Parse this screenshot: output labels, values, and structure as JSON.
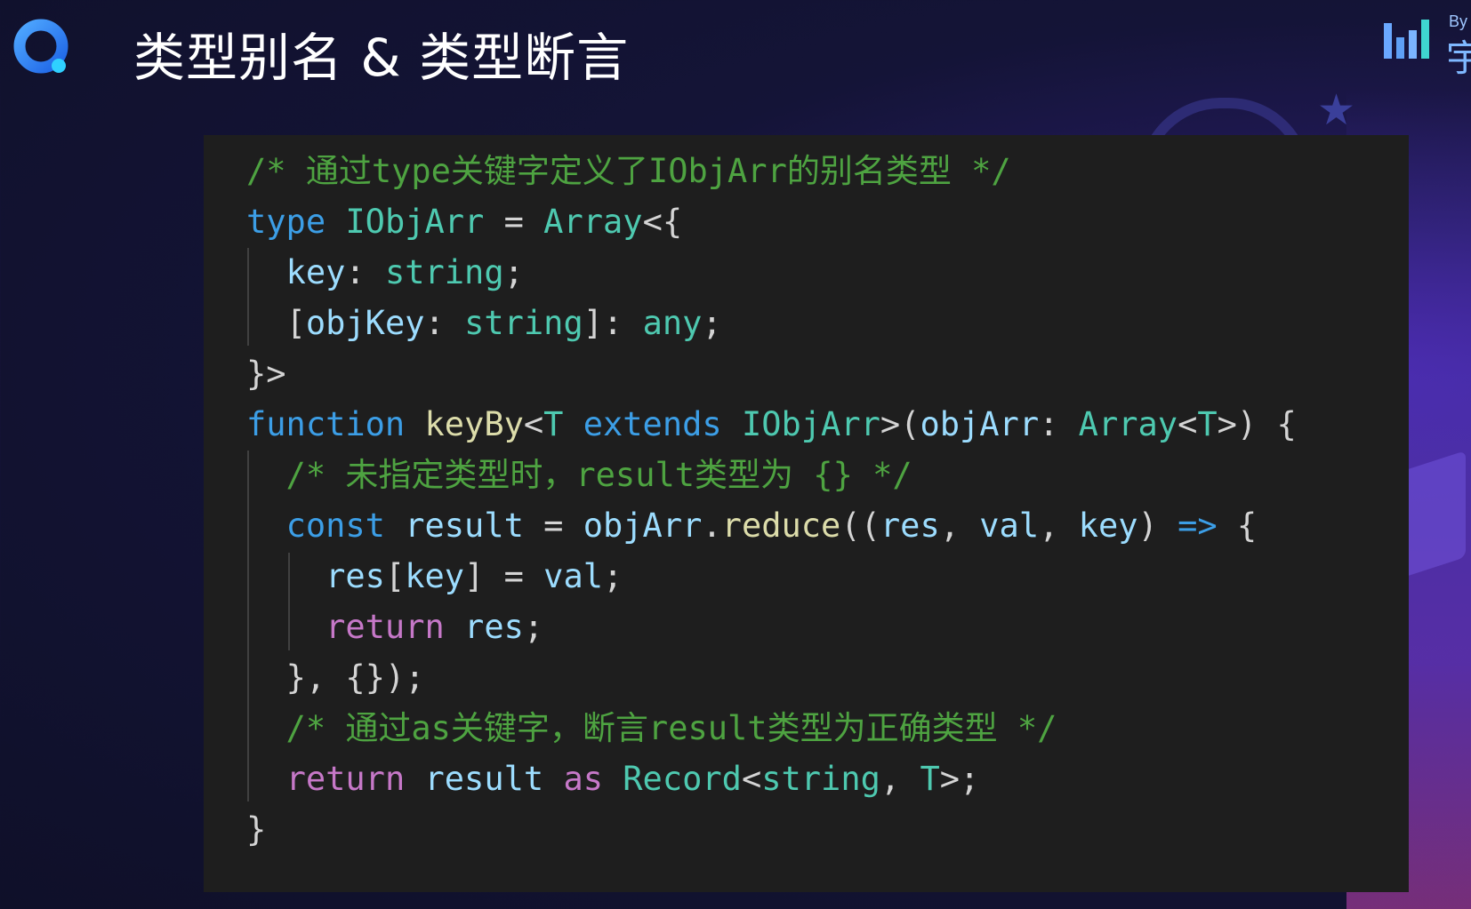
{
  "header": {
    "title": "类型别名 & 类型断言",
    "brand_by": "By",
    "brand_char": "宇"
  },
  "code": {
    "lines": [
      "/* 通过type关键字定义了IObjArr的别名类型 */",
      "type IObjArr = Array<{",
      "  key: string;",
      "  [objKey: string]: any;",
      "}>",
      "function keyBy<T extends IObjArr>(objArr: Array<T>) {",
      "  /* 未指定类型时，result类型为 {} */",
      "  const result = objArr.reduce((res, val, key) => {",
      "    res[key] = val;",
      "    return res;",
      "  }, {});",
      "  /* 通过as关键字，断言result类型为正确类型 */",
      "  return result as Record<string, T>;",
      "}"
    ]
  },
  "colors": {
    "background": "#141437",
    "code_background": "#1e1e1e",
    "comment": "#4ea341",
    "keyword": "#3c9ee6",
    "control": "#c678c8",
    "type": "#4ec9b0",
    "variable": "#9cdcfe",
    "function": "#dcdcaa"
  },
  "icons": {
    "logo": "app-logo-icon",
    "brand": "bar-chart-brand-icon"
  }
}
